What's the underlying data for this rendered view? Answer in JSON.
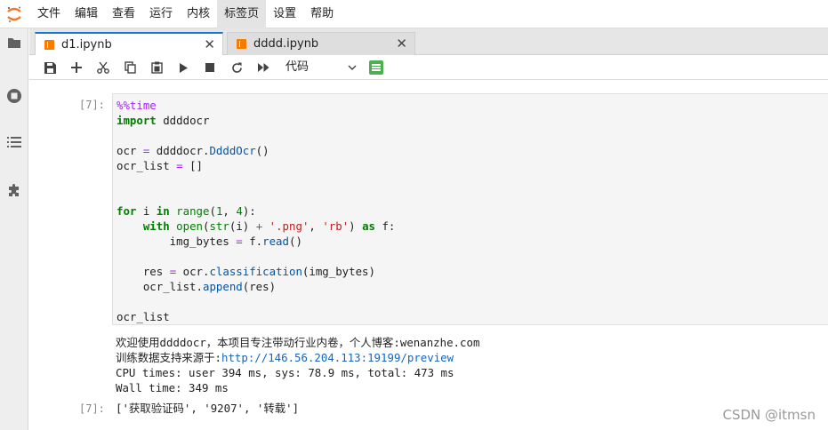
{
  "menubar": {
    "items": [
      "文件",
      "编辑",
      "查看",
      "运行",
      "内核",
      "标签页",
      "设置",
      "帮助"
    ],
    "active_index": 5
  },
  "tabs": [
    {
      "label": "d1.ipynb",
      "active": true
    },
    {
      "label": "dddd.ipynb",
      "active": false
    }
  ],
  "toolbar": {
    "cell_type": "代码",
    "buttons": [
      "save-icon",
      "add-icon",
      "cut-icon",
      "copy-icon",
      "paste-icon",
      "run-icon",
      "stop-icon",
      "restart-icon",
      "fast-forward-icon"
    ]
  },
  "cell1": {
    "prompt": "[7]:",
    "code_lines": [
      "%%time",
      "import ddddocr",
      "",
      "ocr = ddddocr.DdddOcr()",
      "ocr_list = []",
      "",
      "",
      "for i in range(1, 4):",
      "    with open(str(i) + '.png', 'rb') as f:",
      "        img_bytes = f.read()",
      "",
      "    res = ocr.classification(img_bytes)",
      "    ocr_list.append(res)",
      "",
      "ocr_list"
    ],
    "stdout_lines": [
      "欢迎使用ddddocr，本项目专注带动行业内卷，个人博客:wenanzhe.com",
      "训练数据支持来源于:",
      "CPU times: user 394 ms, sys: 78.9 ms, total: 473 ms",
      "Wall time: 349 ms"
    ],
    "link": "http://146.56.204.113:19199/preview"
  },
  "cell1_result": {
    "prompt": "[7]:",
    "value": "['获取验证码', '9207', '转载']"
  },
  "watermark": "CSDN @itmsn",
  "colors": {
    "accent": "#1976d2",
    "logo": "#f37726",
    "toc": "#4caf50"
  }
}
